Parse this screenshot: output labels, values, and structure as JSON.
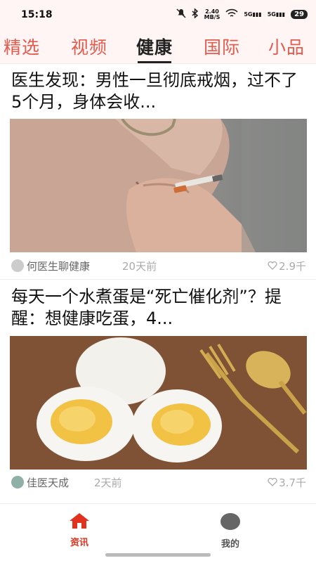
{
  "status": {
    "time": "15:18",
    "net_speed_value": "2.40",
    "net_speed_unit": "MB/S",
    "signal1": "5G",
    "signal2": "5G",
    "battery": "29"
  },
  "tabs": [
    {
      "label": "精选",
      "active": false
    },
    {
      "label": "视频",
      "active": false
    },
    {
      "label": "健康",
      "active": true
    },
    {
      "label": "国际",
      "active": false
    },
    {
      "label": "小品",
      "active": false
    }
  ],
  "articles": [
    {
      "title": "医生发现：男性一旦彻底戒烟，过不了5个月，身体会收...",
      "author": "何医生聊健康",
      "time": "20天前",
      "likes": "2.9千",
      "image_icon": "smoking-hand-photo"
    },
    {
      "title": "每天一个水煮蛋是“死亡催化剂”？提醒：想健康吃蛋，4...",
      "author": "佳医天成",
      "time": "2天前",
      "likes": "3.7千",
      "image_icon": "boiled-eggs-photo"
    }
  ],
  "bottom_nav": {
    "news_label": "资讯",
    "mine_label": "我的",
    "active_color": "#e0321e",
    "inactive_color": "#555555"
  }
}
